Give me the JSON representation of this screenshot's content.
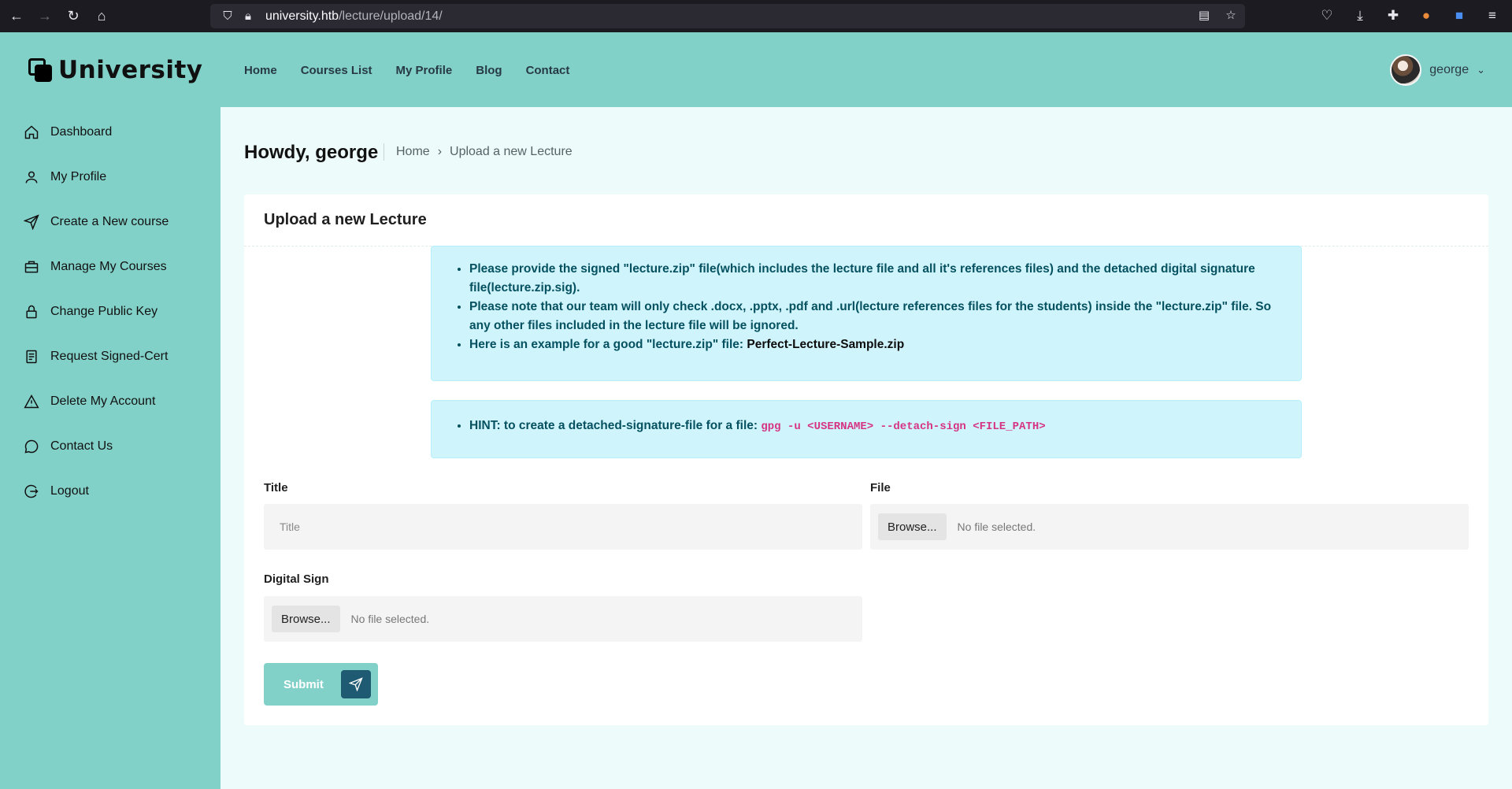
{
  "browser": {
    "url_host": "university.htb",
    "url_path": "/lecture/upload/14/"
  },
  "header": {
    "logo_text": "University",
    "nav": [
      "Home",
      "Courses List",
      "My Profile",
      "Blog",
      "Contact"
    ],
    "user_name": "george"
  },
  "sidebar": {
    "items": [
      {
        "label": "Dashboard",
        "icon": "home-icon"
      },
      {
        "label": "My Profile",
        "icon": "user-icon"
      },
      {
        "label": "Create a New course",
        "icon": "send-icon"
      },
      {
        "label": "Manage My Courses",
        "icon": "briefcase-icon"
      },
      {
        "label": "Change Public Key",
        "icon": "lock-icon"
      },
      {
        "label": "Request Signed-Cert",
        "icon": "document-icon"
      },
      {
        "label": "Delete My Account",
        "icon": "warning-icon"
      },
      {
        "label": "Contact Us",
        "icon": "chat-icon"
      },
      {
        "label": "Logout",
        "icon": "logout-icon"
      }
    ]
  },
  "page": {
    "greeting": "Howdy, george",
    "breadcrumb_home": "Home",
    "breadcrumb_sep": "›",
    "breadcrumb_current": "Upload a new Lecture"
  },
  "card": {
    "title": "Upload a new Lecture",
    "info_items": [
      "Please provide the signed \"lecture.zip\" file(which includes the lecture file and all it's references files) and the detached digital signature file(lecture.zip.sig).",
      "Please note that our team will only check .docx, .pptx, .pdf and .url(lecture references files for the students) inside the \"lecture.zip\" file. So any other files included in the lecture file will be ignored.",
      "Here is an example for a good \"lecture.zip\" file: "
    ],
    "sample_link": "Perfect-Lecture-Sample.zip",
    "hint_text": "HINT: to create a detached-signature-file for a file: ",
    "hint_code": "gpg -u <USERNAME> --detach-sign <FILE_PATH>"
  },
  "form": {
    "title_label": "Title",
    "title_placeholder": "Title",
    "file_label": "File",
    "sign_label": "Digital Sign",
    "browse_label": "Browse...",
    "no_file": "No file selected.",
    "submit_label": "Submit"
  }
}
